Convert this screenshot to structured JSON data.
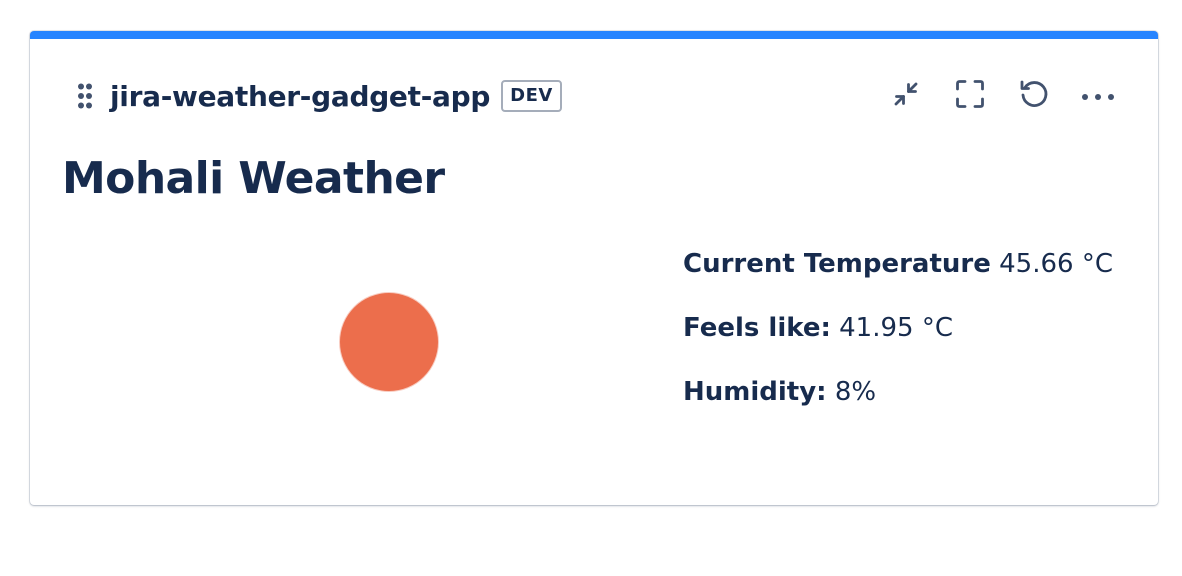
{
  "gadget": {
    "app_name": "jira-weather-gadget-app",
    "env_badge": "DEV",
    "accent_color": "#2684ff"
  },
  "header_actions": [
    {
      "icon": "minimize-icon"
    },
    {
      "icon": "fullscreen-icon"
    },
    {
      "icon": "refresh-icon"
    },
    {
      "icon": "more-icon"
    }
  ],
  "weather": {
    "title": "Mohali Weather",
    "icon": "sun-icon",
    "icon_color": "#ec6e4c",
    "current_temperature": {
      "label": "Current Temperature",
      "value": "45.66 °C"
    },
    "feels_like": {
      "label": "Feels like:",
      "value": "41.95 °C"
    },
    "humidity": {
      "label": "Humidity:",
      "value": "8%"
    }
  }
}
